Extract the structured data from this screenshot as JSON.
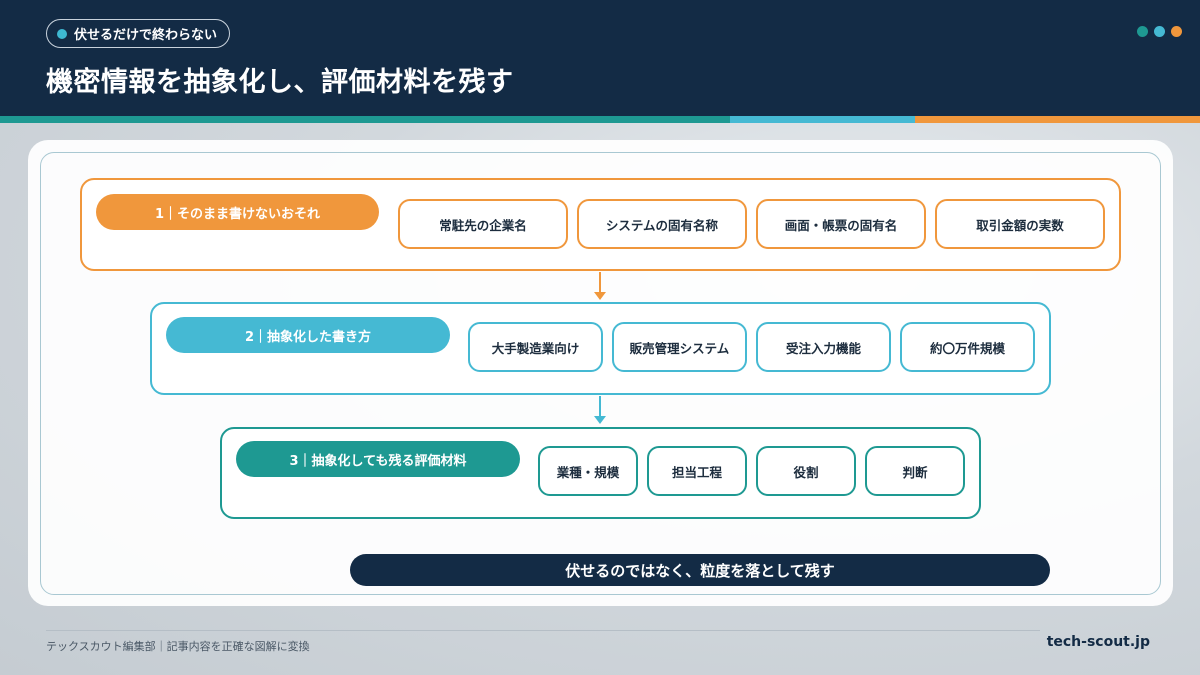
{
  "header": {
    "kicker": "伏せるだけで終わらない",
    "title": "機密情報を抽象化し、評価材料を残す",
    "colors": {
      "background": "#132b45",
      "orange": "#f0973c",
      "cyan": "#45b9d3",
      "teal": "#1e9992"
    }
  },
  "layers": [
    {
      "label": "1｜そのまま書けないおそれ",
      "color": "#f0973c",
      "items": [
        "常駐先の企業名",
        "システムの固有名称",
        "画面・帳票の固有名",
        "取引金額の実数"
      ]
    },
    {
      "label": "2｜抽象化した書き方",
      "color": "#45b9d3",
      "items": [
        "大手製造業向け",
        "販売管理システム",
        "受注入力機能",
        "約〇万件規模"
      ]
    },
    {
      "label": "3｜抽象化しても残る評価材料",
      "color": "#1e9992",
      "items": [
        "業種・規模",
        "担当工程",
        "役割",
        "判断"
      ]
    }
  ],
  "banner": "伏せるのではなく、粒度を落として残す",
  "footer": {
    "left": "テックスカウト編集部｜記事内容を正確な図解に変換",
    "right": "tech-scout.jp"
  }
}
